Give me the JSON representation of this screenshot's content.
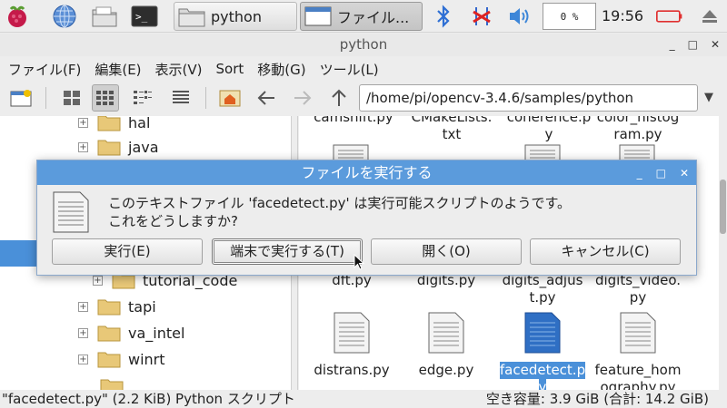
{
  "taskbar": {
    "tasks": [
      {
        "label": "python"
      },
      {
        "label": "ファイル..."
      }
    ],
    "cpu": "0 %",
    "clock": "19:56"
  },
  "window": {
    "title": "python",
    "menu": [
      "ファイル(F)",
      "編集(E)",
      "表示(V)",
      "Sort",
      "移動(G)",
      "ツール(L)"
    ],
    "path": "/home/pi/opencv-3.4.6/samples/python"
  },
  "tree": {
    "items": [
      {
        "label": "hal"
      },
      {
        "label": "java"
      },
      {
        "label": "tutorial_code"
      },
      {
        "label": "tapi"
      },
      {
        "label": "va_intel"
      },
      {
        "label": "winrt"
      }
    ]
  },
  "files": [
    {
      "name": "camshift.py"
    },
    {
      "name": "CMakeLists.txt"
    },
    {
      "name": "coherence.py"
    },
    {
      "name": "color_histogram.py"
    },
    {
      "name": "dft.py"
    },
    {
      "name": "digits.py"
    },
    {
      "name": "digits_adjust.py"
    },
    {
      "name": "digits_video.py"
    },
    {
      "name": "distrans.py"
    },
    {
      "name": "edge.py"
    },
    {
      "name": "facedetect.py"
    },
    {
      "name": "feature_homography.py"
    }
  ],
  "file_labels": {
    "r0c1": "txt",
    "r0c2": "y",
    "r0c3": "ram.py",
    "top_cut_0": "camshift.py",
    "top_cut_1": "CMakeLists.",
    "top_cut_2": "coherence.p",
    "top_cut_3": "color_histog",
    "r1c0": "dft.py",
    "r1c1": "digits.py",
    "r1c2a": "digits_adjus",
    "r1c2b": "t.py",
    "r1c3a": "digits_video.",
    "r1c3b": "py",
    "r2c0": "distrans.py",
    "r2c1": "edge.py",
    "r2c2a": "facedetect.p",
    "r2c2b": "y",
    "r2c3a": "feature_hom",
    "r2c3b": "ography.py"
  },
  "status": {
    "left": "\"facedetect.py\" (2.2 KiB) Python スクリプト",
    "right": "空き容量: 3.9 GiB (合計: 14.2 GiB)"
  },
  "dialog": {
    "title": "ファイルを実行する",
    "line1": "このテキストファイル 'facedetect.py' は実行可能スクリプトのようです。",
    "line2": "これをどうしますか?",
    "buttons": {
      "execute": "実行(E)",
      "terminal": "端末で実行する(T)",
      "open": "開く(O)",
      "cancel": "キャンセル(C)"
    }
  },
  "colors": {
    "accent": "#4a90d9",
    "dialog_title": "#5b9bdc",
    "folder": "#e8c878",
    "battery": "#e03030"
  }
}
